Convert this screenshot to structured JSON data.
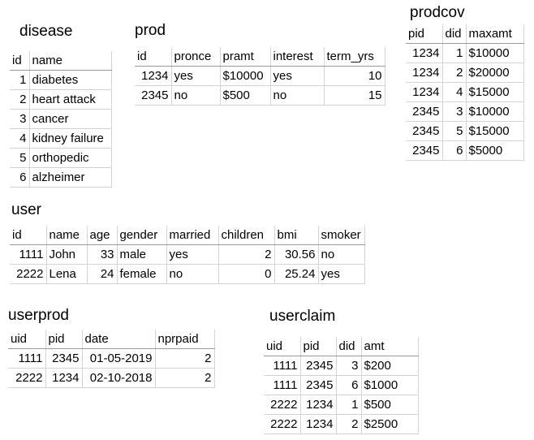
{
  "disease": {
    "title": "disease",
    "headers": [
      "id",
      "name"
    ],
    "rows": [
      [
        "1",
        "diabetes"
      ],
      [
        "2",
        "heart attack"
      ],
      [
        "3",
        "cancer"
      ],
      [
        "4",
        "kidney failure"
      ],
      [
        "5",
        "orthopedic"
      ],
      [
        "6",
        "alzheimer"
      ]
    ]
  },
  "prod": {
    "title": "prod",
    "headers": [
      "id",
      "pronce",
      "pramt",
      "interest",
      "term_yrs"
    ],
    "rows": [
      [
        "1234",
        "yes",
        "$10000",
        "yes",
        "10"
      ],
      [
        "2345",
        "no",
        "$500",
        "no",
        "15"
      ]
    ]
  },
  "prodcov": {
    "title": "prodcov",
    "headers": [
      "pid",
      "did",
      "maxamt"
    ],
    "rows": [
      [
        "1234",
        "1",
        "$10000"
      ],
      [
        "1234",
        "2",
        "$20000"
      ],
      [
        "1234",
        "4",
        "$15000"
      ],
      [
        "2345",
        "3",
        "$10000"
      ],
      [
        "2345",
        "5",
        "$15000"
      ],
      [
        "2345",
        "6",
        "$5000"
      ]
    ]
  },
  "user": {
    "title": "user",
    "headers": [
      "id",
      "name",
      "age",
      "gender",
      "married",
      "children",
      "bmi",
      "smoker"
    ],
    "rows": [
      [
        "1111",
        "John",
        "33",
        "male",
        "yes",
        "2",
        "30.56",
        "no"
      ],
      [
        "2222",
        "Lena",
        "24",
        "female",
        "no",
        "0",
        "25.24",
        "yes"
      ]
    ]
  },
  "userprod": {
    "title": "userprod",
    "headers": [
      "uid",
      "pid",
      "date",
      "nprpaid"
    ],
    "rows": [
      [
        "1111",
        "2345",
        "01-05-2019",
        "2"
      ],
      [
        "2222",
        "1234",
        "02-10-2018",
        "2"
      ]
    ]
  },
  "userclaim": {
    "title": "userclaim",
    "headers": [
      "uid",
      "pid",
      "did",
      "amt"
    ],
    "rows": [
      [
        "1111",
        "2345",
        "3",
        "$200"
      ],
      [
        "1111",
        "2345",
        "6",
        "$1000"
      ],
      [
        "2222",
        "1234",
        "1",
        "$500"
      ],
      [
        "2222",
        "1234",
        "2",
        "$2500"
      ]
    ]
  }
}
